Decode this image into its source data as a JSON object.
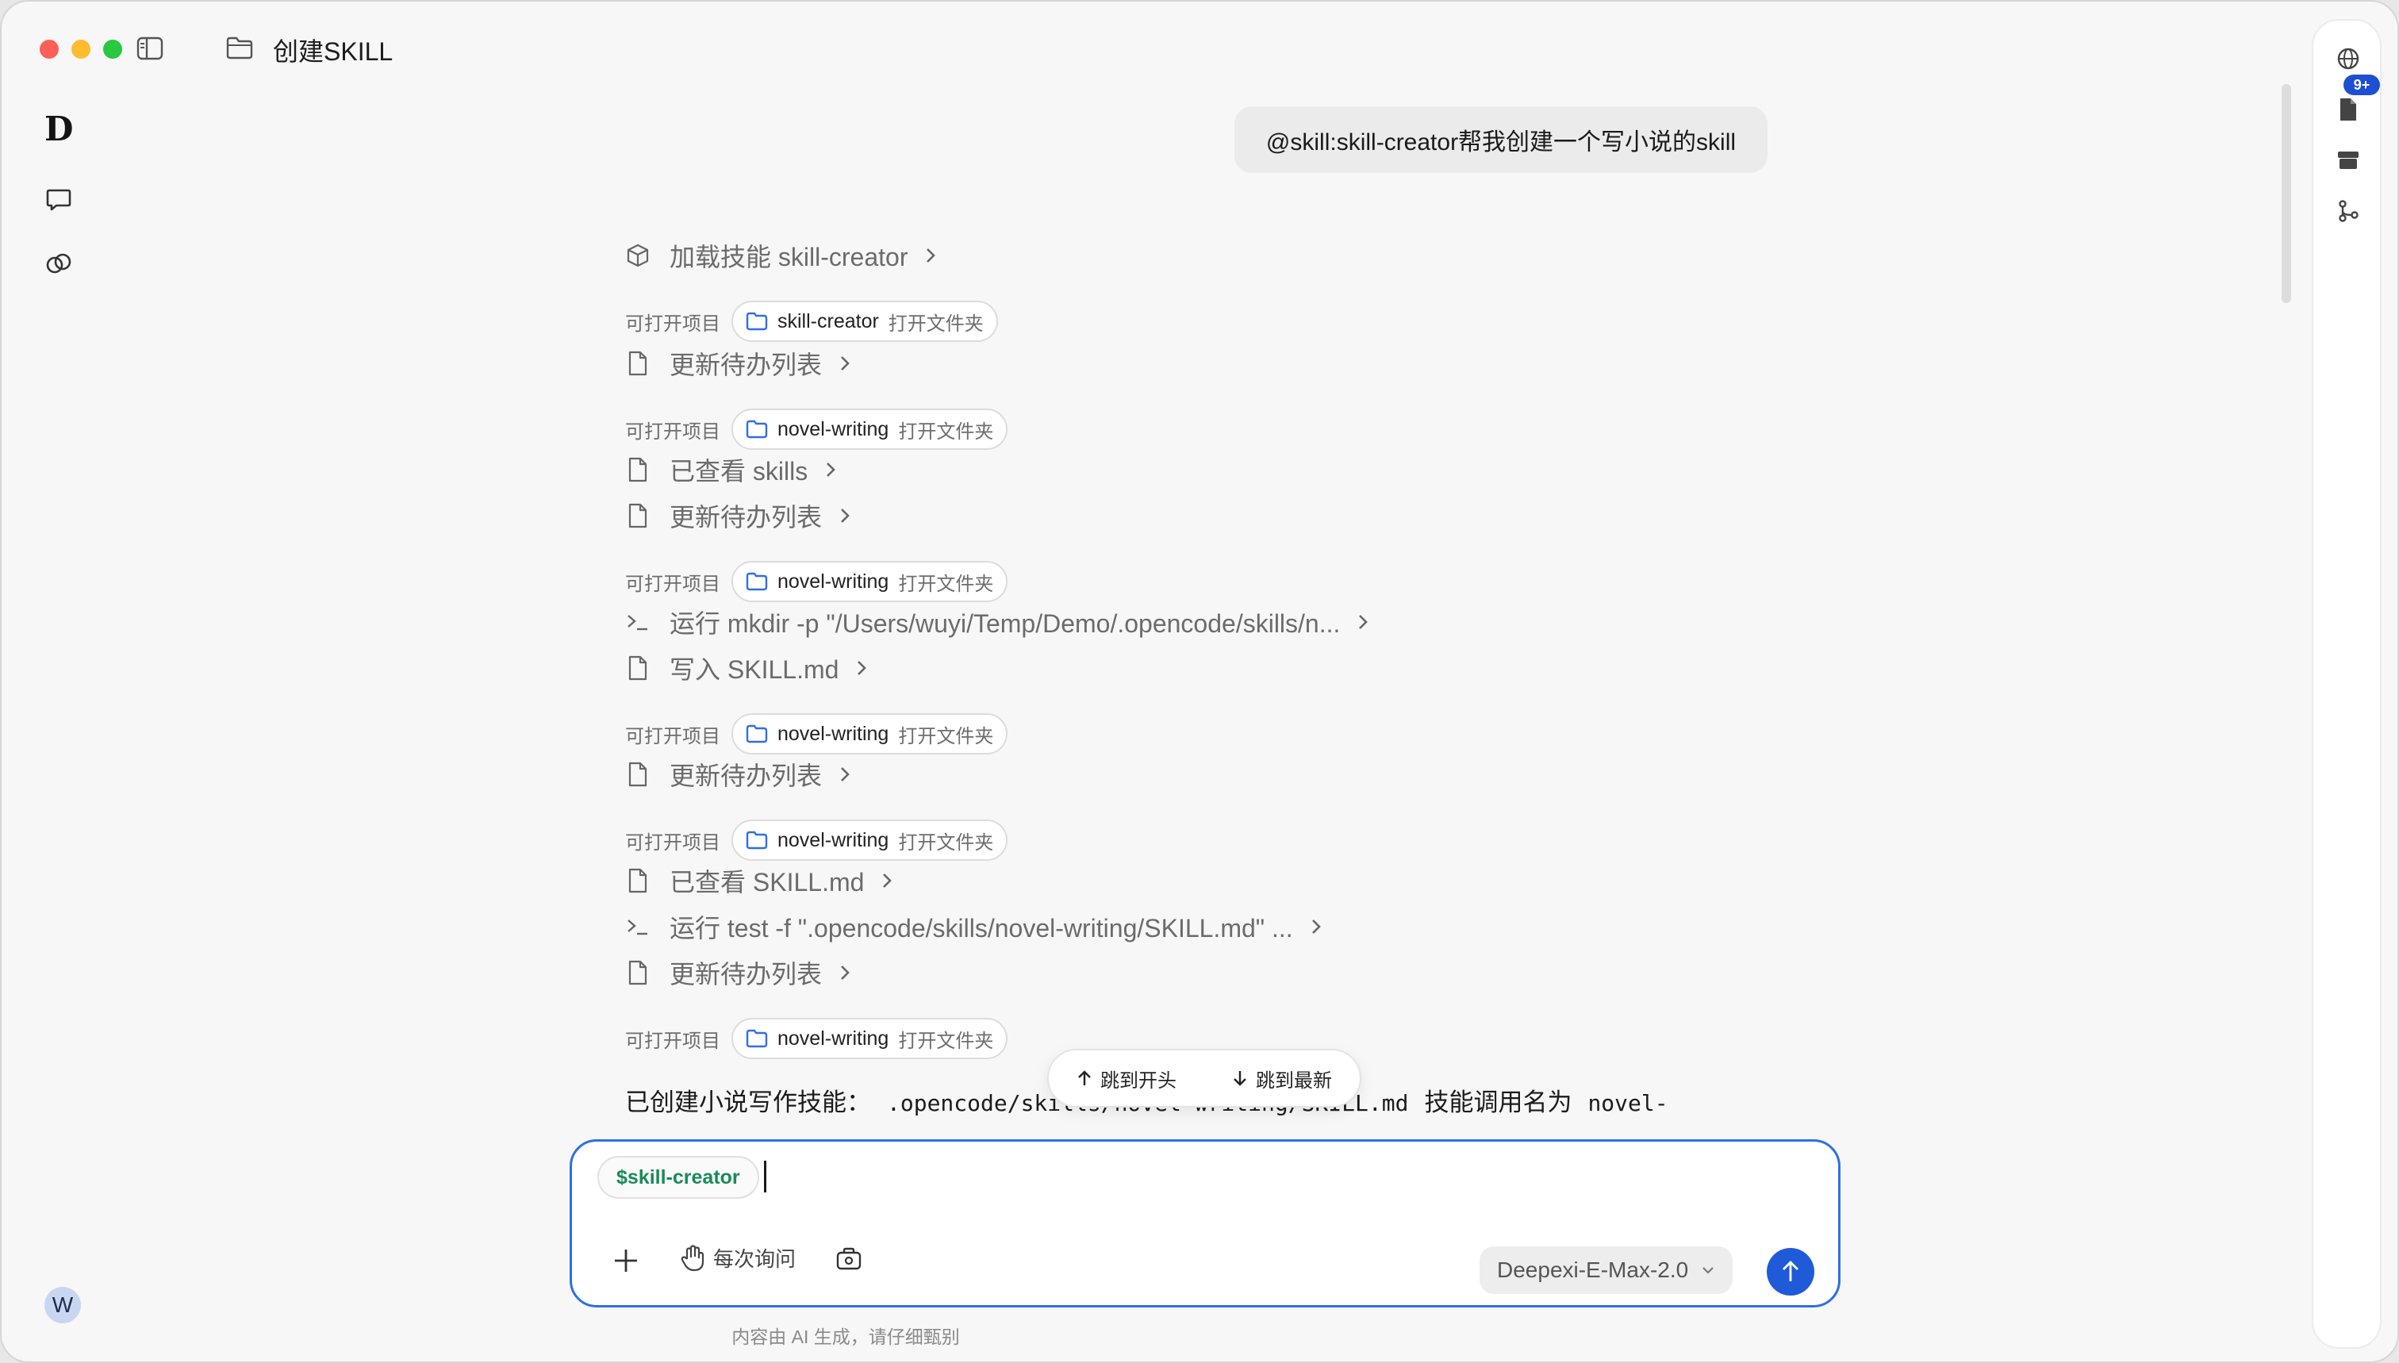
{
  "window": {
    "title": "创建SKILL"
  },
  "left_rail": {
    "logo": "D",
    "avatar_initial": "W"
  },
  "right_rail": {
    "badge": "9+"
  },
  "user_message": "@skill:skill-creator帮我创建一个写小说的skill",
  "openable_label": "可打开项目",
  "open_folder_label": "打开文件夹",
  "steps": {
    "s1": {
      "text": "加载技能 skill-creator",
      "icon": "cube-icon"
    },
    "s2": {
      "text": "更新待办列表",
      "icon": "file-icon"
    },
    "s3": {
      "text": "已查看 skills",
      "icon": "file-icon"
    },
    "s4": {
      "text": "更新待办列表",
      "icon": "file-icon"
    },
    "s5": {
      "text": "运行 mkdir -p \"/Users/wuyi/Temp/Demo/.opencode/skills/n...",
      "icon": "terminal-icon"
    },
    "s6": {
      "text": "写入 SKILL.md",
      "icon": "file-icon"
    },
    "s7": {
      "text": "更新待办列表",
      "icon": "file-icon"
    },
    "s8": {
      "text": "已查看 SKILL.md",
      "icon": "file-icon"
    },
    "s9": {
      "text": "运行 test -f \".opencode/skills/novel-writing/SKILL.md\" ...",
      "icon": "terminal-icon"
    },
    "s10": {
      "text": "更新待办列表",
      "icon": "file-icon"
    }
  },
  "chips": {
    "c1": "skill-creator",
    "c2": "novel-writing",
    "c3": "novel-writing",
    "c4": "novel-writing",
    "c5": "novel-writing",
    "c6": "novel-writing"
  },
  "final_message": {
    "prefix": "已创建小说写作技能：",
    "path": ".opencode/skills/novel-writing/SKILL.md",
    "middle": "技能调用名为",
    "name": "novel-"
  },
  "jump": {
    "top": "跳到开头",
    "latest": "跳到最新"
  },
  "composer": {
    "skill_chip": "$skill-creator",
    "ask_mode": "每次询问",
    "model": "Deepexi-E-Max-2.0"
  },
  "disclaimer": "内容由 AI 生成，请仔细甄别",
  "colors": {
    "accent": "#1f5bd8",
    "skill_green": "#1a8a5a",
    "badge": "#1f4fd1"
  }
}
